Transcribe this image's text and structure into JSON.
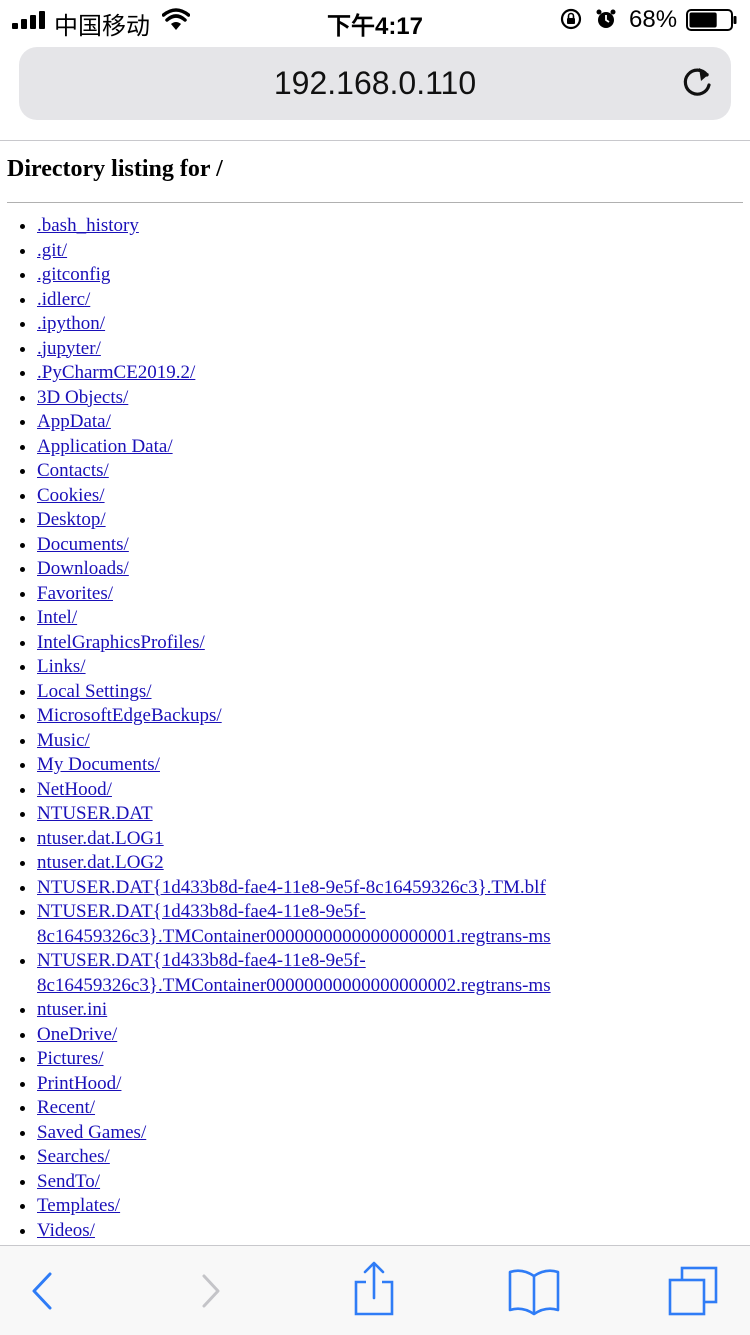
{
  "status_bar": {
    "carrier": "中国移动",
    "time": "下午4:17",
    "battery_percent": "68%",
    "battery_level": 0.68
  },
  "address_bar": {
    "url": "192.168.0.110"
  },
  "page": {
    "title": "Directory listing for /",
    "files": [
      ".bash_history",
      ".git/",
      ".gitconfig",
      ".idlerc/",
      ".ipython/",
      ".jupyter/",
      ".PyCharmCE2019.2/",
      "3D Objects/",
      "AppData/",
      "Application Data/",
      "Contacts/",
      "Cookies/",
      "Desktop/",
      "Documents/",
      "Downloads/",
      "Favorites/",
      "Intel/",
      "IntelGraphicsProfiles/",
      "Links/",
      "Local Settings/",
      "MicrosoftEdgeBackups/",
      "Music/",
      "My Documents/",
      "NetHood/",
      "NTUSER.DAT",
      "ntuser.dat.LOG1",
      "ntuser.dat.LOG2",
      "NTUSER.DAT{1d433b8d-fae4-11e8-9e5f-8c16459326c3}.TM.blf",
      "NTUSER.DAT{1d433b8d-fae4-11e8-9e5f-8c16459326c3}.TMContainer00000000000000000001.regtrans-ms",
      "NTUSER.DAT{1d433b8d-fae4-11e8-9e5f-8c16459326c3}.TMContainer00000000000000000002.regtrans-ms",
      "ntuser.ini",
      "OneDrive/",
      "Pictures/",
      "PrintHood/",
      "Recent/",
      "Saved Games/",
      "Searches/",
      "SendTo/",
      "Templates/",
      "Videos/"
    ]
  },
  "toolbar": {
    "icons": [
      "back-icon",
      "forward-icon",
      "share-icon",
      "bookmarks-icon",
      "tabs-icon"
    ],
    "accent_color": "#2f7cf6",
    "disabled_color": "#c4c4c8"
  },
  "colors": {
    "link": "#1a10b8",
    "address_bar_bg": "#e5e5e8"
  }
}
